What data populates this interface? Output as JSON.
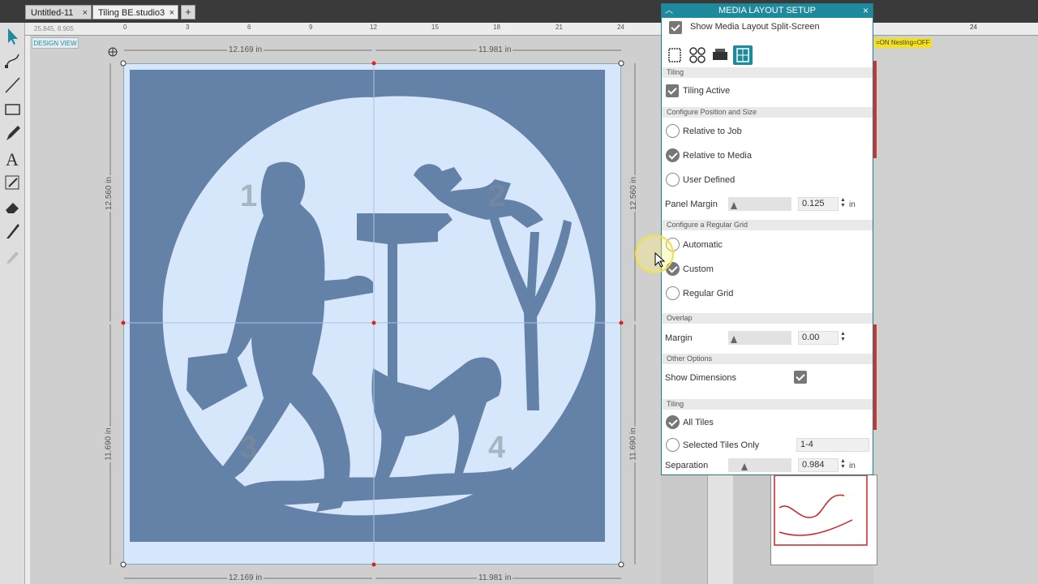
{
  "tabs": [
    {
      "label": "Untitled-11",
      "close": "×"
    },
    {
      "label": "Tiling BE.studio3",
      "close": "×"
    }
  ],
  "tab_add": "+",
  "ruler": {
    "coords": "25.845, 8.905",
    "top_labels": [
      "0",
      "3",
      "6",
      "9",
      "12",
      "15",
      "18",
      "21",
      "24",
      "24"
    ]
  },
  "design_view_label": "DESIGN VIEW",
  "dimensions": {
    "top_left": "12.169 in",
    "top_right": "11.981 in",
    "bottom_left": "12.169 in",
    "bottom_right": "11.981 in",
    "left_upper": "12.560 in",
    "left_lower": "11.690 in",
    "right_upper": "12.560 in",
    "right_lower": "11.690 in"
  },
  "tile_numbers": [
    "1",
    "2",
    "3",
    "4"
  ],
  "panel": {
    "title": "MEDIA LAYOUT SETUP",
    "collapse_icon": "︿",
    "close_icon": "×",
    "show_split_label": "Show Media Layout Split-Screen",
    "sections": {
      "tiling": "Tiling",
      "position_size": "Configure Position and Size",
      "regular_grid": "Configure a Regular Grid",
      "overlap": "Overlap",
      "other": "Other Options",
      "tiling2": "Tiling"
    },
    "tiling_active_label": "Tiling Active",
    "position_options": [
      {
        "label": "Relative to Job",
        "selected": false
      },
      {
        "label": "Relative to Media",
        "selected": true
      },
      {
        "label": "User Defined",
        "selected": false
      }
    ],
    "panel_margin": {
      "label": "Panel Margin",
      "value": "0.125",
      "unit": "in"
    },
    "grid_options": [
      {
        "label": "Automatic",
        "selected": false
      },
      {
        "label": "Custom",
        "selected": true
      },
      {
        "label": "Regular Grid",
        "selected": false
      }
    ],
    "overlap_margin": {
      "label": "Margin",
      "value": "0.00"
    },
    "show_dimensions_label": "Show Dimensions",
    "tile_options": [
      {
        "label": "All Tiles",
        "selected": true
      },
      {
        "label": "Selected Tiles Only",
        "selected": false
      }
    ],
    "selected_tiles_value": "1-4",
    "separation": {
      "label": "Separation",
      "value": "0.984",
      "unit": "in"
    }
  },
  "nesting_badge": "=ON  Nesting=OFF",
  "right_ruler_label": "24",
  "colors": {
    "art": "#6482a8",
    "mat": "#d6e6fb",
    "panel_header": "#1e8a9c"
  }
}
